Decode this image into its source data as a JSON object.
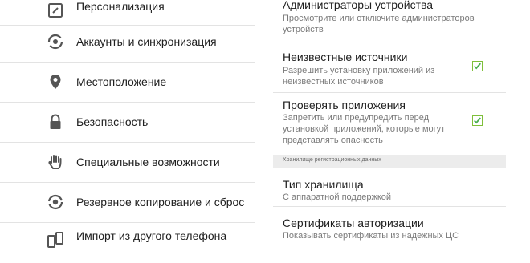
{
  "settings_list": {
    "items": [
      {
        "label": "Персонализация",
        "icon": "personalize-icon"
      },
      {
        "label": "Аккаунты и синхронизация",
        "icon": "sync-icon"
      },
      {
        "label": "Местоположение",
        "icon": "location-pin-icon"
      },
      {
        "label": "Безопасность",
        "icon": "lock-icon"
      },
      {
        "label": "Специальные возможности",
        "icon": "hand-icon"
      },
      {
        "label": "Резервное копирование и сброс",
        "icon": "backup-icon"
      },
      {
        "label": "Импорт из другого телефона",
        "icon": "phone-import-icon"
      }
    ]
  },
  "security": {
    "device_admins": {
      "title": "Администраторы устройства",
      "subtitle_line1": "Просмотрите или отключите администраторов",
      "subtitle_line2": "устройств"
    },
    "unknown_sources": {
      "title": "Неизвестные источники",
      "subtitle_line1": "Разрешить установку приложений из",
      "subtitle_line2": "неизвестных источников",
      "checked": true
    },
    "verify_apps": {
      "title": "Проверять приложения",
      "subtitle_line1": "Запретить или предупредить перед",
      "subtitle_line2": "установкой приложений, которые могут",
      "subtitle_line3": "представлять опасность",
      "checked": true
    },
    "credential_storage_header": "Хранилище регистрационных данных",
    "storage_type": {
      "title": "Тип хранилища",
      "subtitle": "С аппаратной поддержкой"
    },
    "trusted_credentials": {
      "title": "Сертификаты авторизации",
      "subtitle": "Показывать сертификаты из надежных ЦС"
    }
  },
  "colors": {
    "accent_check": "#4caf50",
    "divider": "#e3e3e3",
    "icon": "#555555"
  }
}
